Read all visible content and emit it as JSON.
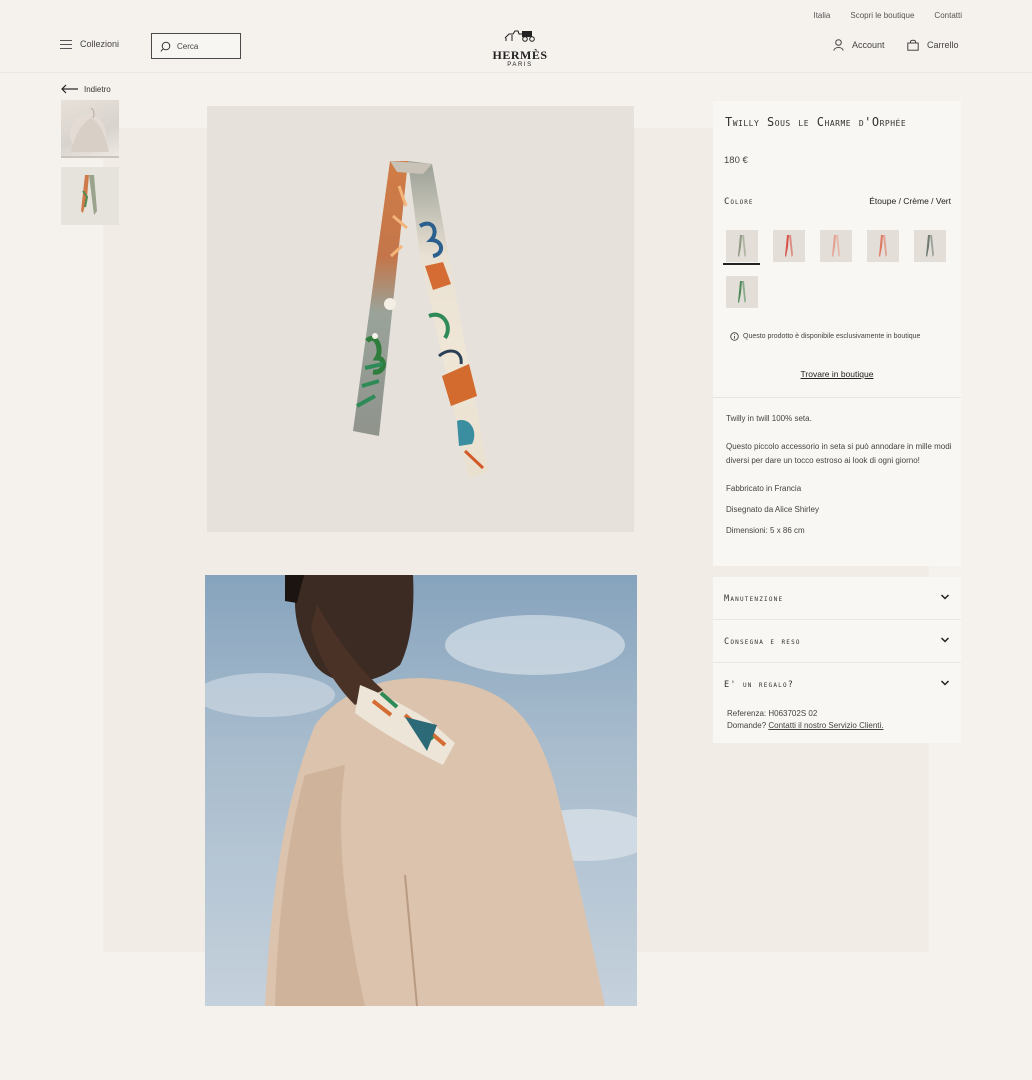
{
  "header": {
    "top_links": [
      "Italia",
      "Scopri le boutique",
      "Contatti"
    ],
    "menu_label": "Collezioni",
    "search_placeholder": "Cerca",
    "logo_name": "HERMÈS",
    "logo_sub": "PARIS",
    "account_label": "Account",
    "cart_label": "Carrello"
  },
  "nav": {
    "back_label": "Indietro"
  },
  "product": {
    "name": "Twilly Sous le Charme d'Orphée",
    "price": "180 €",
    "color_label": "Colore",
    "color_value": "Étoupe / Crème / Vert",
    "swatches": [
      {
        "name": "Étoupe / Crème / Vert",
        "color": "#8e9a82",
        "selected": true
      },
      {
        "name": "variant-2",
        "color": "#d9534a"
      },
      {
        "name": "variant-3",
        "color": "#e6a090"
      },
      {
        "name": "variant-4",
        "color": "#e07860"
      },
      {
        "name": "variant-5",
        "color": "#6d7a72"
      },
      {
        "name": "variant-6",
        "color": "#4f8a5c"
      }
    ],
    "availability_notice": "Questo prodotto è disponibile esclusivamente in boutique",
    "find_in_boutique": "Trovare in boutique",
    "description": [
      "Twilly in twill 100% seta.",
      "Questo piccolo accessorio in seta si può annodare in mille modi diversi per dare un tocco estroso ai look di ogni giorno!",
      "Fabbricato in Francia",
      "Disegnato da Alice Shirley",
      "Dimensioni: 5 x 86 cm"
    ]
  },
  "accordion": [
    {
      "label": "Manutenzione"
    },
    {
      "label": "Consegna e reso"
    },
    {
      "label": "E' un regalo?"
    }
  ],
  "reference": {
    "ref_text": "Referenza:  H063702S 02",
    "questions_text": "Domande?",
    "contact_link": "Contatti il nostro Servizio Clienti."
  }
}
